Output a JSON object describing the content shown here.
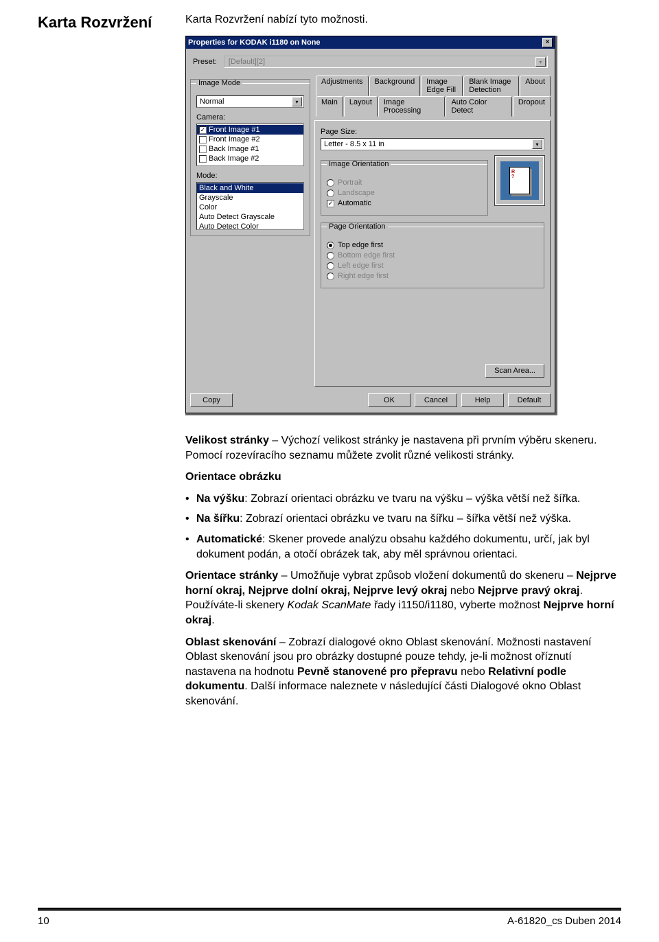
{
  "page": {
    "heading": "Karta Rozvržení",
    "intro": "Karta Rozvržení nabízí tyto možnosti.",
    "number": "10",
    "doc_id": "A-61820_cs  Duben 2014"
  },
  "dialog": {
    "title": "Properties for KODAK i1180 on None",
    "preset_label": "Preset:",
    "preset_value": "[Default][2]",
    "image_mode": {
      "legend": "Image Mode",
      "value": "Normal",
      "camera_label": "Camera:",
      "camera_items": [
        "Front Image #1",
        "Front Image #2",
        "Back Image #1",
        "Back Image #2"
      ],
      "mode_label": "Mode:",
      "mode_items": [
        "Black and White",
        "Grayscale",
        "Color",
        "Auto Detect Grayscale",
        "Auto Detect Color"
      ]
    },
    "tabs_row1": [
      "Adjustments",
      "Background",
      "Image Edge Fill",
      "Blank Image Detection",
      "About"
    ],
    "tabs_row2": [
      "Main",
      "Layout",
      "Image Processing",
      "Auto Color Detect",
      "Dropout"
    ],
    "active_tab": "Layout",
    "page_size_label": "Page Size:",
    "page_size_value": "Letter - 8.5 x 11 in",
    "image_orientation": {
      "legend": "Image Orientation",
      "portrait": "Portrait",
      "landscape": "Landscape",
      "automatic": "Automatic",
      "auto_checked": true
    },
    "page_orientation": {
      "legend": "Page Orientation",
      "top": "Top edge first",
      "bottom": "Bottom edge first",
      "left": "Left edge first",
      "right": "Right edge first"
    },
    "scan_area_btn": "Scan Area...",
    "buttons": {
      "copy": "Copy",
      "ok": "OK",
      "cancel": "Cancel",
      "help": "Help",
      "default": "Default"
    }
  },
  "body": {
    "p1a": "Velikost stránky",
    "p1b": " – Výchozí velikost stránky je nastavena při prvním výběru skeneru. Pomocí rozevíracího seznamu můžete zvolit různé velikosti stránky.",
    "p2": "Orientace obrázku",
    "li1a": "Na výšku",
    "li1b": ": Zobrazí orientaci obrázku ve tvaru na výšku – výška větší než šířka.",
    "li2a": "Na šířku",
    "li2b": ": Zobrazí orientaci obrázku ve tvaru na šířku – šířka větší než výška.",
    "li3a": "Automatické",
    "li3b": ": Skener provede analýzu obsahu každého dokumentu, určí, jak byl dokument podán, a otočí obrázek tak, aby měl správnou orientaci.",
    "p3a": "Orientace stránky",
    "p3b": " – Umožňuje vybrat způsob vložení dokumentů do skeneru – ",
    "p3c": "Nejprve horní okraj, Nejprve dolní okraj, Nejprve levý okraj",
    "p3d": " nebo ",
    "p3e": "Nejprve pravý okraj",
    "p3f": ". Používáte-li skenery ",
    "p3g": "Kodak ScanMate",
    "p3h": " řady i1150/i1180, vyberte možnost ",
    "p3i": "Nejprve horní okraj",
    "p3j": ".",
    "p4a": "Oblast skenování",
    "p4b": " – Zobrazí dialogové okno Oblast skenování. Možnosti nastavení Oblast skenování jsou pro obrázky dostupné pouze tehdy, je-li možnost oříznutí nastavena na hodnotu ",
    "p4c": "Pevně stanovené pro přepravu",
    "p4d": " nebo ",
    "p4e": "Relativní podle dokumentu",
    "p4f": ". Další informace naleznete v následující části Dialogové okno Oblast skenování."
  }
}
